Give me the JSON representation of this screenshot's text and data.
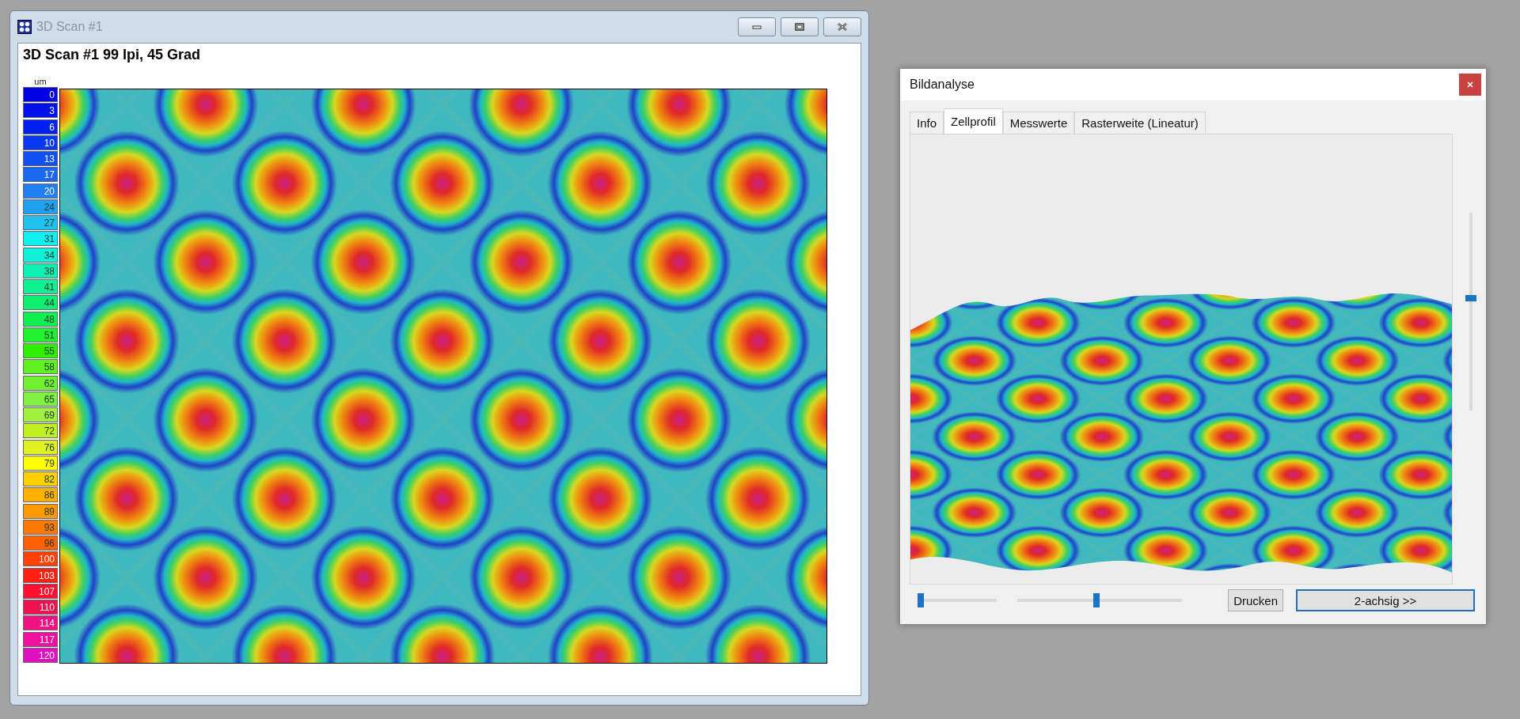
{
  "window": {
    "title": "3D Scan #1",
    "heading": "3D Scan #1 99 lpi, 45 Grad"
  },
  "legend": {
    "unit": "um",
    "entries": [
      {
        "value": "0",
        "color": "#0000e0"
      },
      {
        "value": "3",
        "color": "#0010e8"
      },
      {
        "value": "6",
        "color": "#0020f0"
      },
      {
        "value": "10",
        "color": "#0838f0"
      },
      {
        "value": "13",
        "color": "#1050f0"
      },
      {
        "value": "17",
        "color": "#1868f0"
      },
      {
        "value": "20",
        "color": "#2080f0"
      },
      {
        "value": "24",
        "color": "#20a0f0"
      },
      {
        "value": "27",
        "color": "#20c0f0"
      },
      {
        "value": "31",
        "color": "#10f0f0"
      },
      {
        "value": "34",
        "color": "#10f0d8"
      },
      {
        "value": "38",
        "color": "#10f0b0"
      },
      {
        "value": "41",
        "color": "#10f090"
      },
      {
        "value": "44",
        "color": "#10f070"
      },
      {
        "value": "48",
        "color": "#10f050"
      },
      {
        "value": "51",
        "color": "#20f030"
      },
      {
        "value": "55",
        "color": "#30f000"
      },
      {
        "value": "58",
        "color": "#60f020"
      },
      {
        "value": "62",
        "color": "#70f030"
      },
      {
        "value": "65",
        "color": "#80f040"
      },
      {
        "value": "69",
        "color": "#a0f040"
      },
      {
        "value": "72",
        "color": "#c0f020"
      },
      {
        "value": "76",
        "color": "#e0f020"
      },
      {
        "value": "79",
        "color": "#ffff00"
      },
      {
        "value": "82",
        "color": "#ffd000"
      },
      {
        "value": "86",
        "color": "#ffb000"
      },
      {
        "value": "89",
        "color": "#ff9800"
      },
      {
        "value": "93",
        "color": "#ff7800"
      },
      {
        "value": "96",
        "color": "#ff6000"
      },
      {
        "value": "100",
        "color": "#ff4000"
      },
      {
        "value": "103",
        "color": "#ff2010"
      },
      {
        "value": "107",
        "color": "#ff1030"
      },
      {
        "value": "110",
        "color": "#f01050"
      },
      {
        "value": "114",
        "color": "#f01080"
      },
      {
        "value": "117",
        "color": "#f010a0"
      },
      {
        "value": "120",
        "color": "#e010c0"
      }
    ]
  },
  "dialog": {
    "title": "Bildanalyse",
    "tabs": [
      {
        "label": "Info",
        "selected": false
      },
      {
        "label": "Zellprofil",
        "selected": true
      },
      {
        "label": "Messwerte",
        "selected": false
      },
      {
        "label": "Rasterweite (Lineatur)",
        "selected": false
      }
    ],
    "vertical_slider": {
      "level": 0.57
    },
    "sliders": [
      {
        "level": 0
      },
      {
        "level": 0.48
      }
    ],
    "buttons": [
      {
        "label": "Drucken",
        "default": false
      },
      {
        "label": "2-achsig >>",
        "default": true
      }
    ]
  }
}
